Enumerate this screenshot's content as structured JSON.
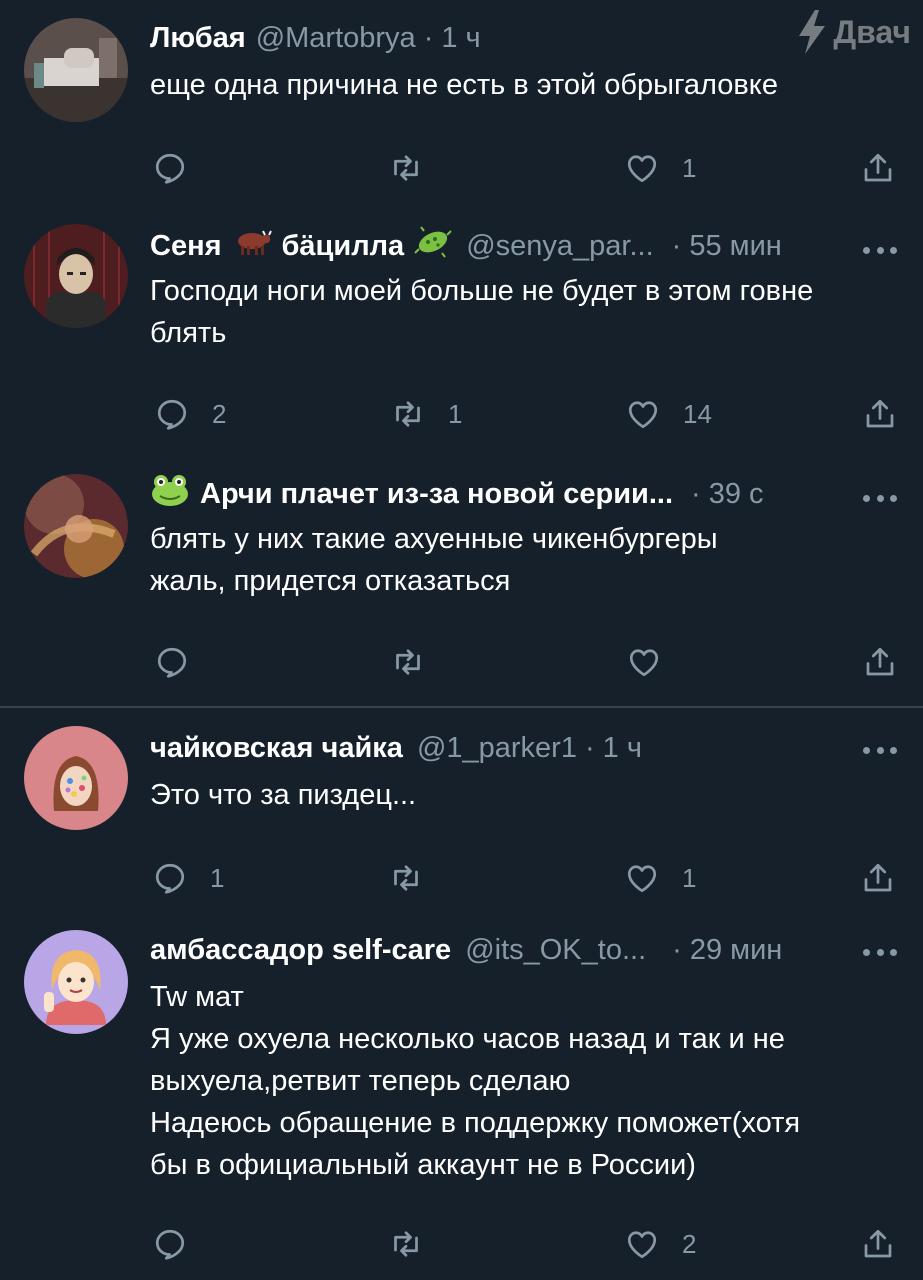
{
  "watermark": {
    "label": "Двач",
    "icon": "lightning-icon"
  },
  "tweets": [
    {
      "name": "Любая",
      "handle": "@Martobrya",
      "dot": "·",
      "time": "1 ч",
      "lines": [
        "еще одна причина не есть в этой обрыгаловке"
      ],
      "replies": "",
      "retweets": "",
      "likes": "1",
      "show_more": false
    },
    {
      "name": "Сеня",
      "name2": "бäцилла",
      "handle": "@senya_par...",
      "dot": "·",
      "time": "55 мин",
      "lines": [
        "Господи ноги моей больше не будет в этом говне",
        "блять"
      ],
      "replies": "2",
      "retweets": "1",
      "likes": "14",
      "show_more": true
    },
    {
      "name": "Арчи плачет из-за новой серии...",
      "handle": "",
      "dot": "·",
      "time": "39 с",
      "lines": [
        "блять у них такие ахуенные чикенбургеры",
        "жаль, придется отказаться"
      ],
      "replies": "",
      "retweets": "",
      "likes": "",
      "show_more": true
    },
    {
      "name": "чайковская чайка",
      "handle": "@1_parker1",
      "dot": "·",
      "time": "1 ч",
      "lines": [
        "Это что за пиздец..."
      ],
      "replies": "1",
      "retweets": "",
      "likes": "1",
      "show_more": true
    },
    {
      "name": "амбассадор self-care",
      "handle": "@its_OK_to...",
      "dot": "·",
      "time": "29 мин",
      "lines": [
        "Tw мат",
        "Я уже охуела несколько часов назад и так и не",
        "выхуела,ретвит теперь сделаю",
        "Надеюсь обращение в поддержку поможет(хотя",
        "бы в официальный аккаунт не в России)"
      ],
      "replies": "",
      "retweets": "",
      "likes": "2",
      "show_more": true
    }
  ],
  "colors": {
    "background": "#15202b",
    "muted": "#8899a6",
    "separator": "#38444d",
    "text": "#ffffff"
  }
}
